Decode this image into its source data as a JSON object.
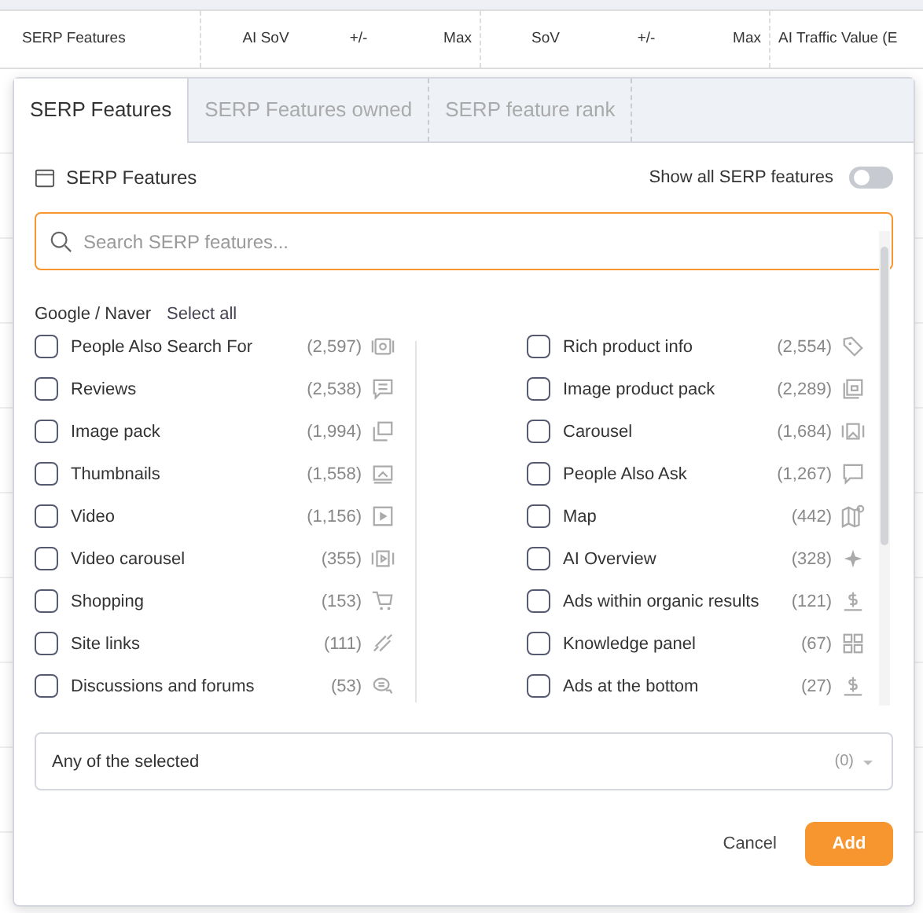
{
  "table": {
    "columns": [
      "SERP Features",
      "AI SoV",
      "+/-",
      "Max",
      "SoV",
      "+/-",
      "Max",
      "AI Traffic Value (E"
    ]
  },
  "dialog": {
    "tabs": [
      {
        "label": "SERP Features",
        "selected": true
      },
      {
        "label": "SERP Features owned",
        "selected": false
      },
      {
        "label": "SERP feature rank",
        "selected": false
      }
    ],
    "title": "SERP Features",
    "show_all": {
      "label": "Show all SERP features",
      "on": false
    },
    "search": {
      "placeholder": "Search SERP features..."
    },
    "group": {
      "label": "Google / Naver",
      "select_all": "Select all"
    },
    "left_items": [
      {
        "label": "People Also Search For",
        "count": "(2,597)",
        "checked": false
      },
      {
        "label": "Reviews",
        "count": "(2,538)",
        "checked": false
      },
      {
        "label": "Image pack",
        "count": "(1,994)",
        "checked": false
      },
      {
        "label": "Thumbnails",
        "count": "(1,558)",
        "checked": false
      },
      {
        "label": "Video",
        "count": "(1,156)",
        "checked": false
      },
      {
        "label": "Video carousel",
        "count": "(355)",
        "checked": false
      },
      {
        "label": "Shopping",
        "count": "(153)",
        "checked": false
      },
      {
        "label": "Site links",
        "count": "(111)",
        "checked": false
      },
      {
        "label": "Discussions and forums",
        "count": "(53)",
        "checked": false
      }
    ],
    "right_items": [
      {
        "label": "Rich product info",
        "count": "(2,554)",
        "checked": false
      },
      {
        "label": "Image product pack",
        "count": "(2,289)",
        "checked": false
      },
      {
        "label": "Carousel",
        "count": "(1,684)",
        "checked": false
      },
      {
        "label": "People Also Ask",
        "count": "(1,267)",
        "checked": false
      },
      {
        "label": "Map",
        "count": "(442)",
        "checked": false
      },
      {
        "label": "AI Overview",
        "count": "(328)",
        "checked": false
      },
      {
        "label": "Ads within organic results",
        "count": "(121)",
        "checked": false
      },
      {
        "label": "Knowledge panel",
        "count": "(67)",
        "checked": false
      },
      {
        "label": "Ads at the bottom",
        "count": "(27)",
        "checked": false
      }
    ],
    "match": {
      "value": "Any of the selected",
      "count": "(0)"
    },
    "buttons": {
      "cancel": "Cancel",
      "add": "Add"
    }
  }
}
